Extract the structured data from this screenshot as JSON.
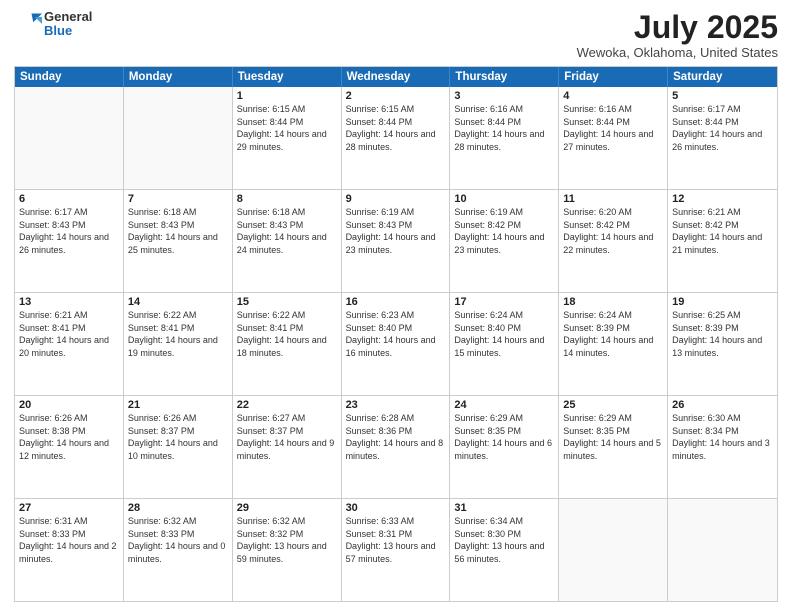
{
  "header": {
    "logo": {
      "general": "General",
      "blue": "Blue"
    },
    "title": "July 2025",
    "location": "Wewoka, Oklahoma, United States"
  },
  "weekdays": [
    "Sunday",
    "Monday",
    "Tuesday",
    "Wednesday",
    "Thursday",
    "Friday",
    "Saturday"
  ],
  "rows": [
    [
      {
        "day": "",
        "sunrise": "",
        "sunset": "",
        "daylight": ""
      },
      {
        "day": "",
        "sunrise": "",
        "sunset": "",
        "daylight": ""
      },
      {
        "day": "1",
        "sunrise": "Sunrise: 6:15 AM",
        "sunset": "Sunset: 8:44 PM",
        "daylight": "Daylight: 14 hours and 29 minutes."
      },
      {
        "day": "2",
        "sunrise": "Sunrise: 6:15 AM",
        "sunset": "Sunset: 8:44 PM",
        "daylight": "Daylight: 14 hours and 28 minutes."
      },
      {
        "day": "3",
        "sunrise": "Sunrise: 6:16 AM",
        "sunset": "Sunset: 8:44 PM",
        "daylight": "Daylight: 14 hours and 28 minutes."
      },
      {
        "day": "4",
        "sunrise": "Sunrise: 6:16 AM",
        "sunset": "Sunset: 8:44 PM",
        "daylight": "Daylight: 14 hours and 27 minutes."
      },
      {
        "day": "5",
        "sunrise": "Sunrise: 6:17 AM",
        "sunset": "Sunset: 8:44 PM",
        "daylight": "Daylight: 14 hours and 26 minutes."
      }
    ],
    [
      {
        "day": "6",
        "sunrise": "Sunrise: 6:17 AM",
        "sunset": "Sunset: 8:43 PM",
        "daylight": "Daylight: 14 hours and 26 minutes."
      },
      {
        "day": "7",
        "sunrise": "Sunrise: 6:18 AM",
        "sunset": "Sunset: 8:43 PM",
        "daylight": "Daylight: 14 hours and 25 minutes."
      },
      {
        "day": "8",
        "sunrise": "Sunrise: 6:18 AM",
        "sunset": "Sunset: 8:43 PM",
        "daylight": "Daylight: 14 hours and 24 minutes."
      },
      {
        "day": "9",
        "sunrise": "Sunrise: 6:19 AM",
        "sunset": "Sunset: 8:43 PM",
        "daylight": "Daylight: 14 hours and 23 minutes."
      },
      {
        "day": "10",
        "sunrise": "Sunrise: 6:19 AM",
        "sunset": "Sunset: 8:42 PM",
        "daylight": "Daylight: 14 hours and 23 minutes."
      },
      {
        "day": "11",
        "sunrise": "Sunrise: 6:20 AM",
        "sunset": "Sunset: 8:42 PM",
        "daylight": "Daylight: 14 hours and 22 minutes."
      },
      {
        "day": "12",
        "sunrise": "Sunrise: 6:21 AM",
        "sunset": "Sunset: 8:42 PM",
        "daylight": "Daylight: 14 hours and 21 minutes."
      }
    ],
    [
      {
        "day": "13",
        "sunrise": "Sunrise: 6:21 AM",
        "sunset": "Sunset: 8:41 PM",
        "daylight": "Daylight: 14 hours and 20 minutes."
      },
      {
        "day": "14",
        "sunrise": "Sunrise: 6:22 AM",
        "sunset": "Sunset: 8:41 PM",
        "daylight": "Daylight: 14 hours and 19 minutes."
      },
      {
        "day": "15",
        "sunrise": "Sunrise: 6:22 AM",
        "sunset": "Sunset: 8:41 PM",
        "daylight": "Daylight: 14 hours and 18 minutes."
      },
      {
        "day": "16",
        "sunrise": "Sunrise: 6:23 AM",
        "sunset": "Sunset: 8:40 PM",
        "daylight": "Daylight: 14 hours and 16 minutes."
      },
      {
        "day": "17",
        "sunrise": "Sunrise: 6:24 AM",
        "sunset": "Sunset: 8:40 PM",
        "daylight": "Daylight: 14 hours and 15 minutes."
      },
      {
        "day": "18",
        "sunrise": "Sunrise: 6:24 AM",
        "sunset": "Sunset: 8:39 PM",
        "daylight": "Daylight: 14 hours and 14 minutes."
      },
      {
        "day": "19",
        "sunrise": "Sunrise: 6:25 AM",
        "sunset": "Sunset: 8:39 PM",
        "daylight": "Daylight: 14 hours and 13 minutes."
      }
    ],
    [
      {
        "day": "20",
        "sunrise": "Sunrise: 6:26 AM",
        "sunset": "Sunset: 8:38 PM",
        "daylight": "Daylight: 14 hours and 12 minutes."
      },
      {
        "day": "21",
        "sunrise": "Sunrise: 6:26 AM",
        "sunset": "Sunset: 8:37 PM",
        "daylight": "Daylight: 14 hours and 10 minutes."
      },
      {
        "day": "22",
        "sunrise": "Sunrise: 6:27 AM",
        "sunset": "Sunset: 8:37 PM",
        "daylight": "Daylight: 14 hours and 9 minutes."
      },
      {
        "day": "23",
        "sunrise": "Sunrise: 6:28 AM",
        "sunset": "Sunset: 8:36 PM",
        "daylight": "Daylight: 14 hours and 8 minutes."
      },
      {
        "day": "24",
        "sunrise": "Sunrise: 6:29 AM",
        "sunset": "Sunset: 8:35 PM",
        "daylight": "Daylight: 14 hours and 6 minutes."
      },
      {
        "day": "25",
        "sunrise": "Sunrise: 6:29 AM",
        "sunset": "Sunset: 8:35 PM",
        "daylight": "Daylight: 14 hours and 5 minutes."
      },
      {
        "day": "26",
        "sunrise": "Sunrise: 6:30 AM",
        "sunset": "Sunset: 8:34 PM",
        "daylight": "Daylight: 14 hours and 3 minutes."
      }
    ],
    [
      {
        "day": "27",
        "sunrise": "Sunrise: 6:31 AM",
        "sunset": "Sunset: 8:33 PM",
        "daylight": "Daylight: 14 hours and 2 minutes."
      },
      {
        "day": "28",
        "sunrise": "Sunrise: 6:32 AM",
        "sunset": "Sunset: 8:33 PM",
        "daylight": "Daylight: 14 hours and 0 minutes."
      },
      {
        "day": "29",
        "sunrise": "Sunrise: 6:32 AM",
        "sunset": "Sunset: 8:32 PM",
        "daylight": "Daylight: 13 hours and 59 minutes."
      },
      {
        "day": "30",
        "sunrise": "Sunrise: 6:33 AM",
        "sunset": "Sunset: 8:31 PM",
        "daylight": "Daylight: 13 hours and 57 minutes."
      },
      {
        "day": "31",
        "sunrise": "Sunrise: 6:34 AM",
        "sunset": "Sunset: 8:30 PM",
        "daylight": "Daylight: 13 hours and 56 minutes."
      },
      {
        "day": "",
        "sunrise": "",
        "sunset": "",
        "daylight": ""
      },
      {
        "day": "",
        "sunrise": "",
        "sunset": "",
        "daylight": ""
      }
    ]
  ]
}
